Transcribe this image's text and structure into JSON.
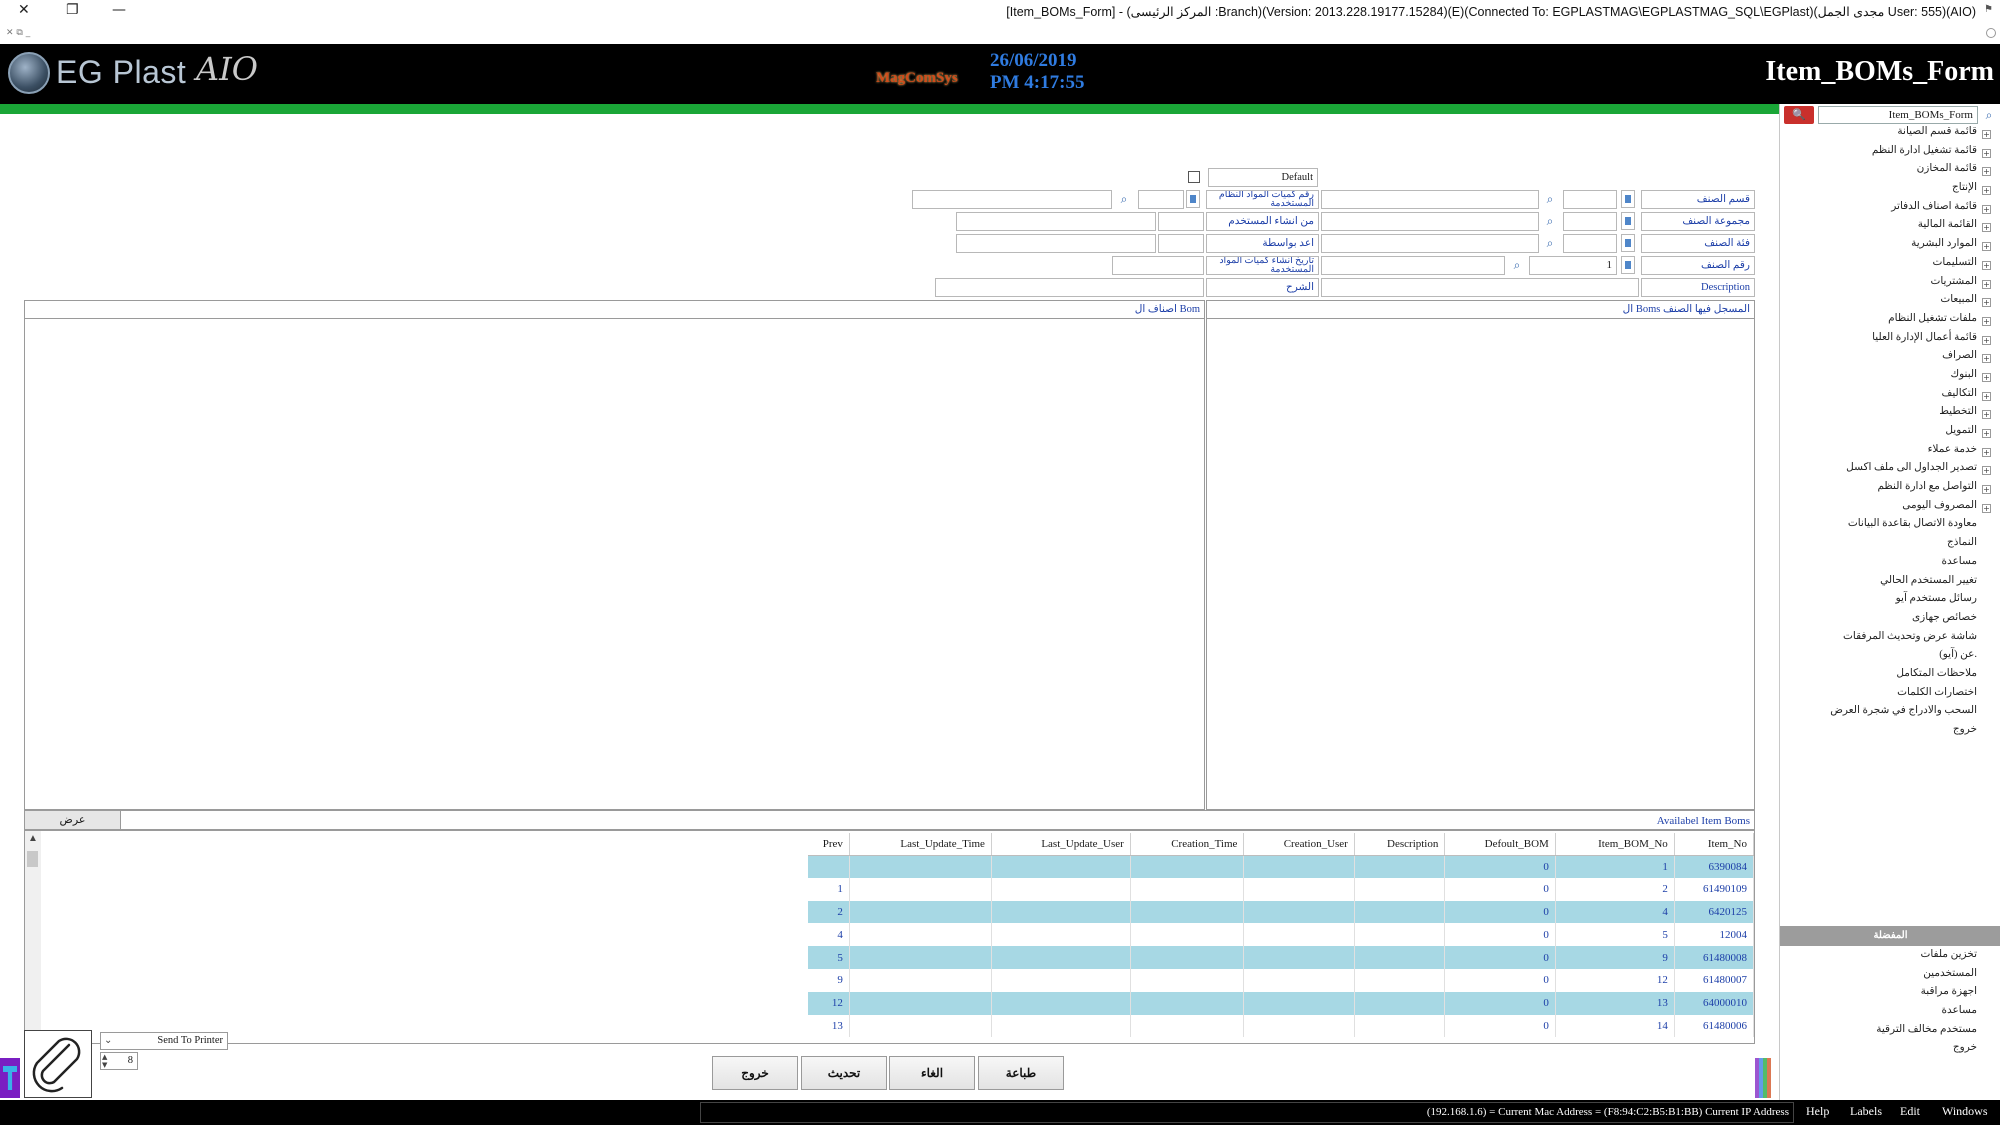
{
  "window": {
    "title": "[Item_BOMs_Form] - (المركز الرئيسى :Branch)(Version: 2013.228.19177.15284)(E)(Connected To: EGPLASTMAG\\EGPLASTMAG_SQL\\EGPlast)(مجدى الجمل User: 555)(AIO)",
    "close_glyph": "✕",
    "restore_glyph": "❐",
    "minimize_glyph": "—",
    "mdi_glyphs": "✕ ⧉ _"
  },
  "header": {
    "logo_text": "EG Plast",
    "logo_suffix": "AIO",
    "brand": "MagComSys",
    "date": "26/06/2019",
    "time": "PM 4:17:55",
    "form_name": "Item_BOMs_Form"
  },
  "nav": {
    "search_value": "Item_BOMs_Form",
    "search_icon": "search-icon",
    "items": [
      {
        "label": "قائمة قسم الصيانة",
        "expandable": true
      },
      {
        "label": "قائمة تشغيل ادارة النظم",
        "expandable": true
      },
      {
        "label": "قائمة المخازن",
        "expandable": true
      },
      {
        "label": "الإنتاج",
        "expandable": true
      },
      {
        "label": "قائمة اصناف الدفاتر",
        "expandable": true
      },
      {
        "label": "القائمة المالية",
        "expandable": true
      },
      {
        "label": "الموارد البشرية",
        "expandable": true
      },
      {
        "label": "التسليمات",
        "expandable": true
      },
      {
        "label": "المشتريات",
        "expandable": true
      },
      {
        "label": "المبيعات",
        "expandable": true
      },
      {
        "label": "ملفات تشغيل النظام",
        "expandable": true
      },
      {
        "label": "قائمة أعمال الإدارة العليا",
        "expandable": true
      },
      {
        "label": "الصراف",
        "expandable": true
      },
      {
        "label": "البنوك",
        "expandable": true
      },
      {
        "label": "التكاليف",
        "expandable": true
      },
      {
        "label": "التخطيط",
        "expandable": true
      },
      {
        "label": "التمويل",
        "expandable": true
      },
      {
        "label": "خدمة عملاء",
        "expandable": true
      },
      {
        "label": "تصدير الجداول الى ملف اكسل",
        "expandable": true
      },
      {
        "label": "التواصل مع ادارة النظم",
        "expandable": true
      },
      {
        "label": "المصروف اليومى",
        "expandable": true
      },
      {
        "label": "معاودة الاتصال بقاعدة البيانات",
        "expandable": false
      },
      {
        "label": "النماذج",
        "expandable": false
      },
      {
        "label": "مساعدة",
        "expandable": false
      },
      {
        "label": "تغيير المستخدم الحالي",
        "expandable": false
      },
      {
        "label": "رسائل مستخدم آيو",
        "expandable": false
      },
      {
        "label": "خصائص جهازى",
        "expandable": false
      },
      {
        "label": "شاشة عرض وتحديث المرفقات",
        "expandable": false
      },
      {
        "label": "عن (آيو).",
        "expandable": false
      },
      {
        "label": "ملاحظات المتكامل",
        "expandable": false
      },
      {
        "label": "اختصارات الكلمات",
        "expandable": false
      },
      {
        "label": "السحب والادراج في شجرة العرض",
        "expandable": false
      },
      {
        "label": "خروج",
        "expandable": false
      }
    ],
    "section_title": "المفضلة",
    "favorites": [
      {
        "label": "تخزين ملفات"
      },
      {
        "label": "المستخدمين"
      },
      {
        "label": "اجهزة مراقبة"
      },
      {
        "label": "مساعدة"
      },
      {
        "label": "مستخدم مخالف الترقية"
      },
      {
        "label": "خروج"
      }
    ]
  },
  "form": {
    "default_label": "Default",
    "default_checked": false,
    "right": {
      "item_category": "قسم الصنف",
      "item_group": "مجموعة الصنف",
      "item_class": "فئة الصنف",
      "item_no": "رقم الصنف",
      "item_no_value": "1",
      "description": "Description"
    },
    "left": {
      "bom_system_no": "رقم كميات المواد النظام المستخدمة",
      "created_by": "من انشاء المستخدم",
      "prepared_by": "اعد بواسطة",
      "creation_date": "تاريخ انشاء كميات المواد المستخدمة",
      "notes": "الشرح"
    }
  },
  "panels": {
    "right_title": "ال Boms المسجل فيها الصنف",
    "left_title": "اصناف ال Bom"
  },
  "grid": {
    "title": "Availabel Item Boms",
    "view_button": "عرض",
    "columns": [
      "Prev",
      "Last_Update_Time",
      "Last_Update_User",
      "Creation_Time",
      "Creation_User",
      "Description",
      "Defoult_BOM",
      "Item_BOM_No",
      "Item_No"
    ],
    "rows": [
      {
        "Prev": "",
        "Last_Update_Time": "",
        "Last_Update_User": "",
        "Creation_Time": "",
        "Creation_User": "",
        "Description": "",
        "Defoult_BOM": "0",
        "Item_BOM_No": "1",
        "Item_No": "6390084"
      },
      {
        "Prev": "1",
        "Last_Update_Time": "",
        "Last_Update_User": "",
        "Creation_Time": "",
        "Creation_User": "",
        "Description": "",
        "Defoult_BOM": "0",
        "Item_BOM_No": "2",
        "Item_No": "61490109"
      },
      {
        "Prev": "2",
        "Last_Update_Time": "",
        "Last_Update_User": "",
        "Creation_Time": "",
        "Creation_User": "",
        "Description": "",
        "Defoult_BOM": "0",
        "Item_BOM_No": "4",
        "Item_No": "6420125"
      },
      {
        "Prev": "4",
        "Last_Update_Time": "",
        "Last_Update_User": "",
        "Creation_Time": "",
        "Creation_User": "",
        "Description": "",
        "Defoult_BOM": "0",
        "Item_BOM_No": "5",
        "Item_No": "12004"
      },
      {
        "Prev": "5",
        "Last_Update_Time": "",
        "Last_Update_User": "",
        "Creation_Time": "",
        "Creation_User": "",
        "Description": "",
        "Defoult_BOM": "0",
        "Item_BOM_No": "9",
        "Item_No": "61480008"
      },
      {
        "Prev": "9",
        "Last_Update_Time": "",
        "Last_Update_User": "",
        "Creation_Time": "",
        "Creation_User": "",
        "Description": "",
        "Defoult_BOM": "0",
        "Item_BOM_No": "12",
        "Item_No": "61480007"
      },
      {
        "Prev": "12",
        "Last_Update_Time": "",
        "Last_Update_User": "",
        "Creation_Time": "",
        "Creation_User": "",
        "Description": "",
        "Defoult_BOM": "0",
        "Item_BOM_No": "13",
        "Item_No": "64000010"
      },
      {
        "Prev": "13",
        "Last_Update_Time": "",
        "Last_Update_User": "",
        "Creation_Time": "",
        "Creation_User": "",
        "Description": "",
        "Defoult_BOM": "0",
        "Item_BOM_No": "14",
        "Item_No": "61480006"
      }
    ]
  },
  "bottom": {
    "printer": "Send To Printer",
    "copies": "8",
    "buttons": {
      "print": "طباعة",
      "cancel": "الغاء",
      "refresh": "تحديث",
      "exit": "خروج"
    }
  },
  "status": {
    "text": "(192.168.1.6) = Current Mac Address = (F8:94:C2:B5:B1:BB) Current IP Address",
    "menus": [
      "Help",
      "Labels",
      "Edit",
      "Windows"
    ]
  },
  "colors": {
    "accent_green": "#1aa637",
    "header_bg": "#000000",
    "row_highlight": "#a7d8e4",
    "link_blue": "#1d3fa8",
    "date_blue": "#2f7be0"
  }
}
